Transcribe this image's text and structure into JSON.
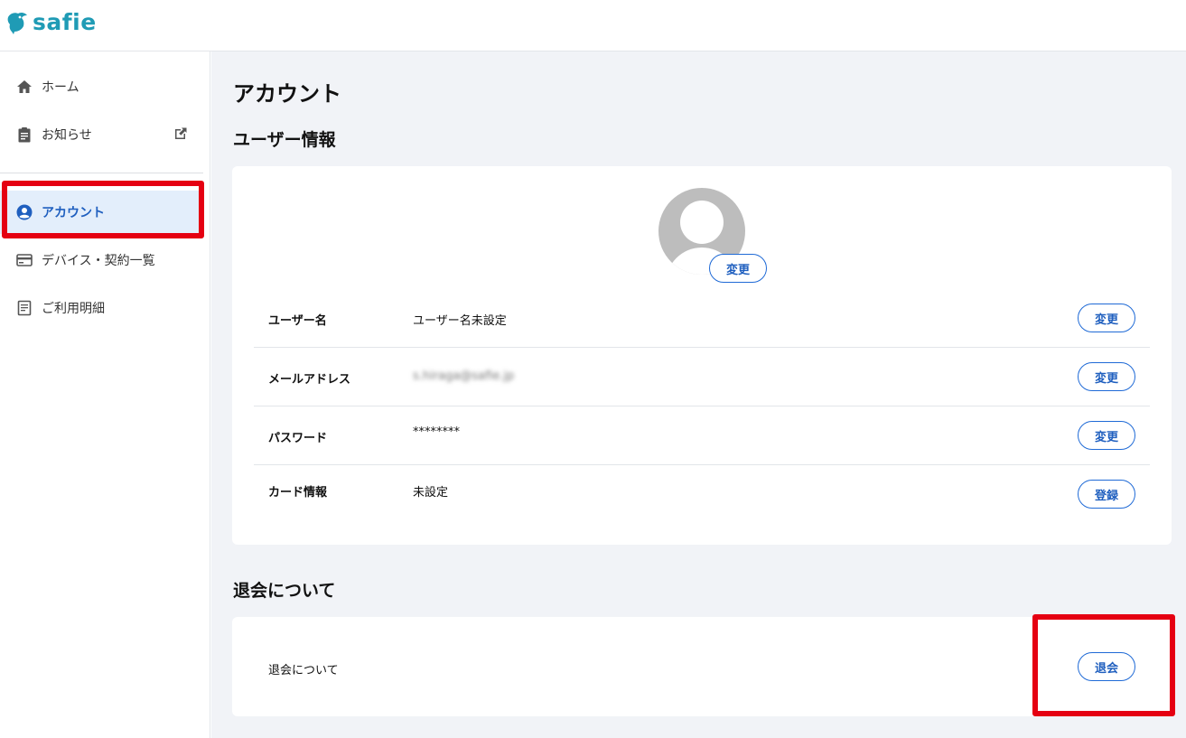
{
  "brand": {
    "name": "safie",
    "color": "#1f9bb5"
  },
  "sidebar": {
    "items": [
      {
        "label": "ホーム",
        "icon": "home-icon"
      },
      {
        "label": "お知らせ",
        "icon": "clipboard-icon",
        "external_icon": "external-link-icon"
      },
      {
        "label": "アカウント",
        "icon": "account-circle-icon",
        "active": true
      },
      {
        "label": "デバイス・契約一覧",
        "icon": "credit-card-icon"
      },
      {
        "label": "ご利用明細",
        "icon": "receipt-icon"
      }
    ]
  },
  "main": {
    "title": "アカウント",
    "user_info": {
      "heading": "ユーザー情報",
      "avatar_button": "変更",
      "rows": [
        {
          "label": "ユーザー名",
          "value": "ユーザー名未設定",
          "button": "変更"
        },
        {
          "label": "メールアドレス",
          "value": "s.hiraga@safie.jp",
          "button": "変更"
        },
        {
          "label": "パスワード",
          "value": "********",
          "button": "変更"
        },
        {
          "label": "カード情報",
          "value": "未設定",
          "button": "登録"
        }
      ]
    },
    "withdraw": {
      "heading": "退会について",
      "label": "退会について",
      "button": "退会"
    }
  },
  "colors": {
    "accent": "#1f6ad6",
    "highlight": "#e50012",
    "active_bg": "#e3eefb"
  }
}
